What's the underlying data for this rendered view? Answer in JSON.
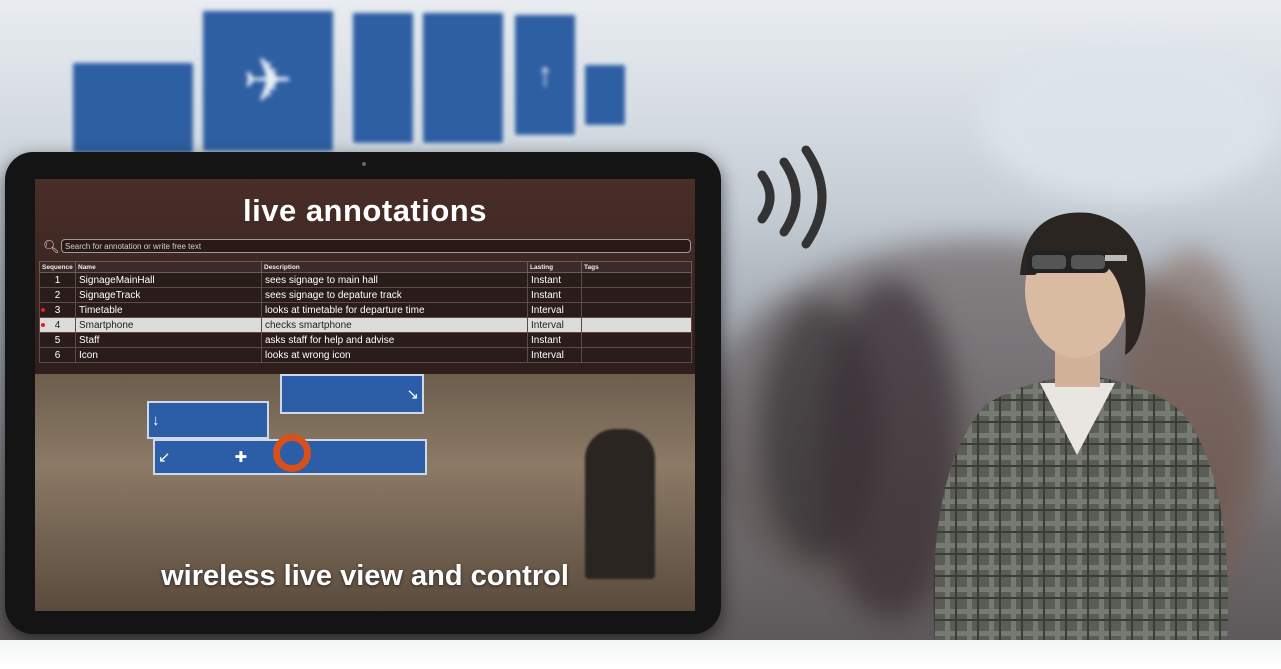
{
  "screen": {
    "title": "live annotations",
    "caption": "wireless live view and control"
  },
  "search": {
    "placeholder": "Search for annotation or write free text",
    "icon": "magnifier-icon"
  },
  "table": {
    "columns": [
      "Sequence",
      "Name",
      "Description",
      "Lasting",
      "Tags"
    ],
    "rows": [
      {
        "seq": "1",
        "name": "SignageMainHall",
        "description": "sees signage to main hall",
        "lasting": "Instant",
        "tags": "",
        "marked": false,
        "selected": false
      },
      {
        "seq": "2",
        "name": "SignageTrack",
        "description": "sees signage to depature track",
        "lasting": "Instant",
        "tags": "",
        "marked": false,
        "selected": false
      },
      {
        "seq": "3",
        "name": "Timetable",
        "description": "looks at timetable for departure time",
        "lasting": "Interval",
        "tags": "",
        "marked": true,
        "selected": false
      },
      {
        "seq": "4",
        "name": "Smartphone",
        "description": "checks smartphone",
        "lasting": "Interval",
        "tags": "",
        "marked": true,
        "selected": true
      },
      {
        "seq": "5",
        "name": "Staff",
        "description": "asks staff for help and advise",
        "lasting": "Instant",
        "tags": "",
        "marked": false,
        "selected": false
      },
      {
        "seq": "6",
        "name": "Icon",
        "description": "looks at wrong icon",
        "lasting": "Interval",
        "tags": "",
        "marked": false,
        "selected": false
      }
    ]
  },
  "colors": {
    "marker": "#e0201c",
    "signage_blue": "#2e5fa3",
    "focus_ring": "#d8501c"
  }
}
